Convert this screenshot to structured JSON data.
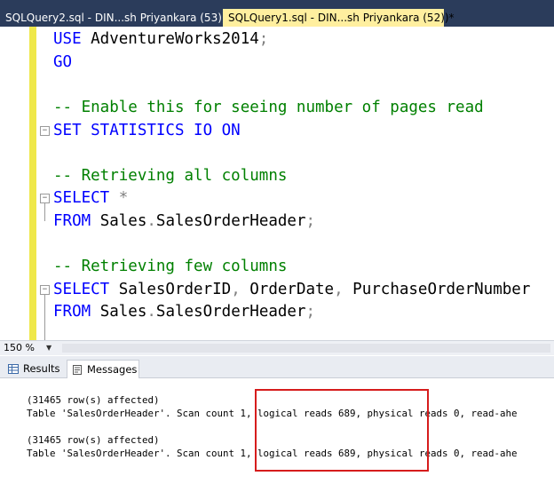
{
  "tabs": [
    {
      "label": "SQLQuery2.sql - DIN...sh Priyankara (53))*",
      "active": false
    },
    {
      "label": "SQLQuery1.sql - DIN...sh Priyankara (52))*",
      "active": true
    }
  ],
  "editor": {
    "lines": [
      {
        "text": "USE AdventureWorks2014;"
      },
      {
        "text": "GO"
      },
      {
        "text": "-- Enable this for seeing number of pages read"
      },
      {
        "text": "SET STATISTICS IO ON"
      },
      {
        "text": "-- Retrieving all columns"
      },
      {
        "text": "SELECT *"
      },
      {
        "text": "FROM Sales.SalesOrderHeader;"
      },
      {
        "text": "-- Retrieving few columns"
      },
      {
        "text": "SELECT SalesOrderID, OrderDate, PurchaseOrderNumber"
      },
      {
        "text": "FROM Sales.SalesOrderHeader;"
      }
    ]
  },
  "status": {
    "zoom": "150 %"
  },
  "results_tabs": [
    {
      "label": "Results",
      "active": false,
      "icon": "grid-icon"
    },
    {
      "label": "Messages",
      "active": true,
      "icon": "messages-icon"
    }
  ],
  "messages": [
    "(31465 row(s) affected)",
    "Table 'SalesOrderHeader'. Scan count 1, logical reads 689, physical reads 0, read-ahe",
    "(31465 row(s) affected)",
    "Table 'SalesOrderHeader'. Scan count 1, logical reads 689, physical reads 0, read-ahe"
  ],
  "colors": {
    "keyword": "#0000ff",
    "comment": "#008000",
    "highlight": "#d61c1c",
    "active_tab": "#ffef9f"
  }
}
